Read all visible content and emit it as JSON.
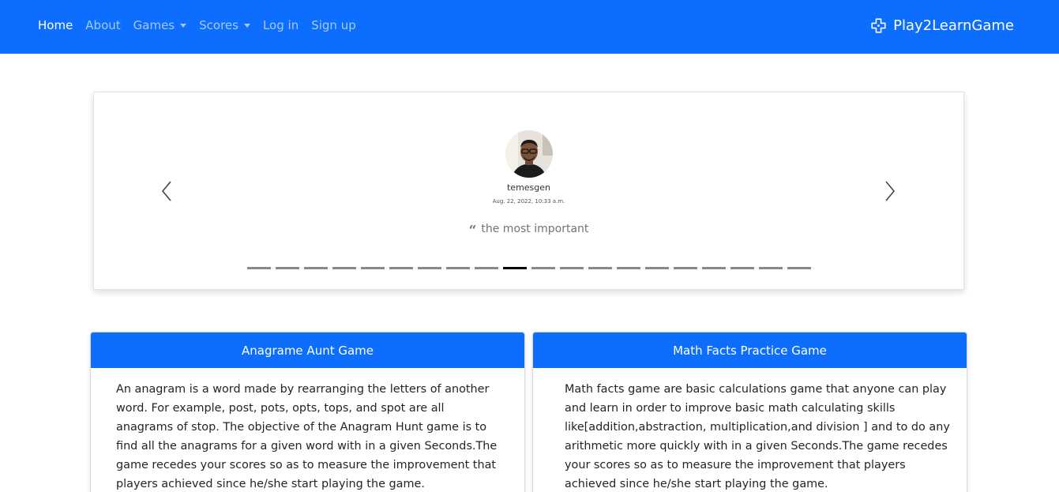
{
  "navbar": {
    "links": [
      {
        "label": "Home"
      },
      {
        "label": "About"
      },
      {
        "label": "Games"
      },
      {
        "label": "Scores"
      },
      {
        "label": "Log in"
      },
      {
        "label": "Sign up"
      }
    ],
    "brand": "Play2LearnGame",
    "background_color": "#0d6efd"
  },
  "carousel": {
    "review": {
      "username": "temesgen",
      "date": "Aug. 22, 2022, 10:33 a.m.",
      "quote": "the most important"
    },
    "indicator_count": 20,
    "active_index": 9
  },
  "games": [
    {
      "title": "Anagrame Aunt Game",
      "description": "An anagram is a word made by rearranging the letters of another word. For example, post, pots, opts, tops, and spot are all anagrams of stop. The objective of the Anagram Hunt game is to find all the anagrams for a given word with in a given Seconds.The game recedes your scores so as to measure the improvement that players achieved since he/she start playing the game."
    },
    {
      "title": "Math Facts Practice Game",
      "description": "Math facts game are basic calculations game that anyone can play and learn in order to improve basic math calculating skills like[addition,abstraction, multiplication,and division ] and to do any arithmetic more quickly with in a given Seconds.The game recedes your scores so as to measure the improvement that players achieved since he/she start playing the game."
    }
  ]
}
